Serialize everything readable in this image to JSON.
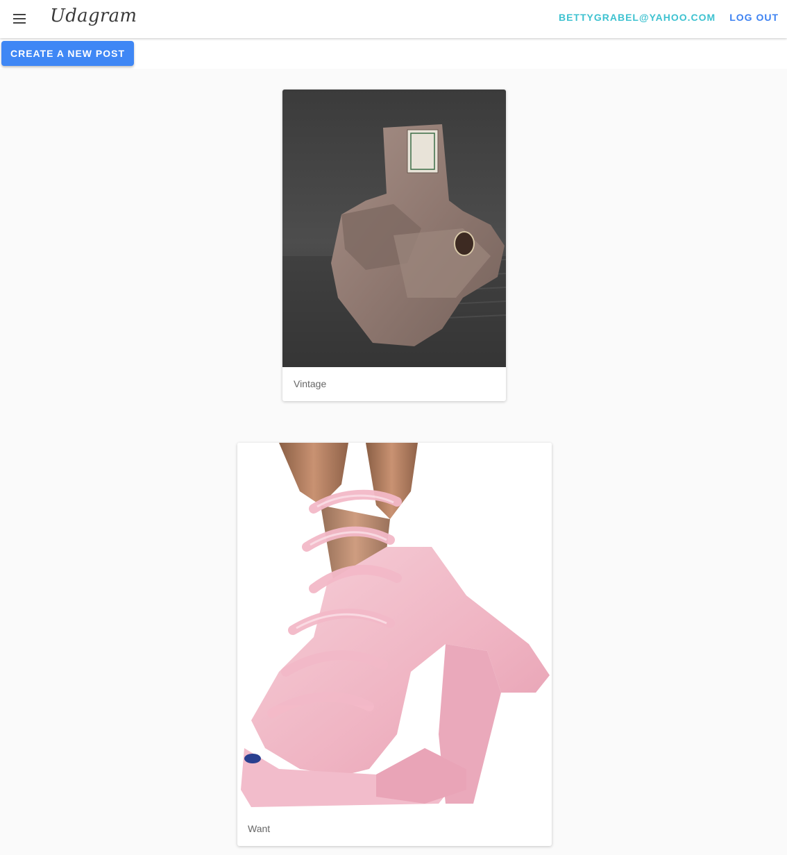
{
  "app": {
    "brand": "Udagram",
    "icons": {
      "menu": "menu-icon"
    }
  },
  "header": {
    "user_email": "BETTYGRABEL@YAHOO.COM",
    "logout_label": "LOG OUT"
  },
  "toolbar": {
    "create_label": "CREATE A NEW POST"
  },
  "feed": {
    "posts": [
      {
        "caption": "Vintage"
      },
      {
        "caption": "Want"
      }
    ]
  },
  "colors": {
    "accent": "#3f87f5",
    "email": "#3ec2d0",
    "logout": "#3d82f2",
    "background": "#fafafa"
  }
}
